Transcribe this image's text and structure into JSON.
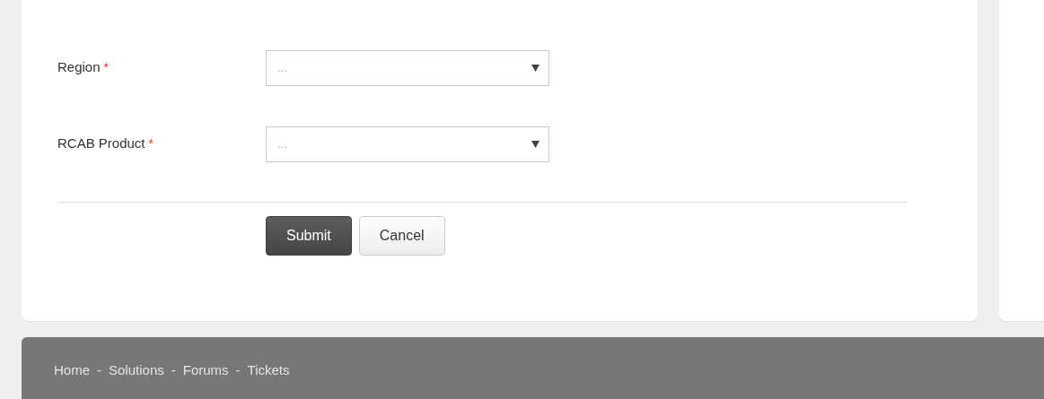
{
  "form": {
    "fields": [
      {
        "label": "Region",
        "required": true,
        "placeholder": "..."
      },
      {
        "label": "RCAB Product",
        "required": true,
        "placeholder": "..."
      }
    ],
    "required_mark": "*",
    "buttons": [
      {
        "label": "Submit",
        "kind": "primary"
      },
      {
        "label": "Cancel",
        "kind": "secondary"
      }
    ]
  },
  "footer": {
    "separator": "-",
    "links": [
      "Home",
      "Solutions",
      "Forums",
      "Tickets"
    ]
  }
}
